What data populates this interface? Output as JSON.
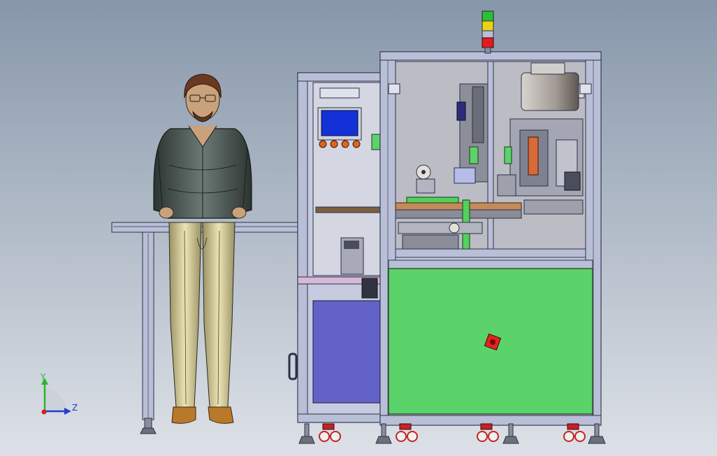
{
  "viewport": {
    "background_top": "#8797aa",
    "background_bottom": "#dde1e7"
  },
  "coordinate_triad": {
    "y_label": "Y",
    "z_label": "Z",
    "y_color": "#2db52d",
    "z_color": "#1f3fd0",
    "origin_color": "#d42020"
  },
  "machine": {
    "frame_color": "#b9bfd6",
    "frame_edge_color": "#2c3046",
    "lower_panel_color": "#5b9c5f",
    "green_panel_color": "#5cd26a",
    "purple_panel_color": "#6262c8",
    "hmi_screen_color": "#1232d8",
    "hmi_button_color": "#e0641c",
    "tower_light_colors": [
      "#e21c1c",
      "#e8d21a",
      "#2bbf3d"
    ],
    "emergency_stop_color": "#e22222",
    "caster_color": "#c62222"
  },
  "operator": {
    "jacket_color": "#3f4a46",
    "pants_color": "#c8c08c",
    "shoe_color": "#b8792a",
    "hair_color": "#6a3a20",
    "skin_color": "#c9a27c"
  }
}
